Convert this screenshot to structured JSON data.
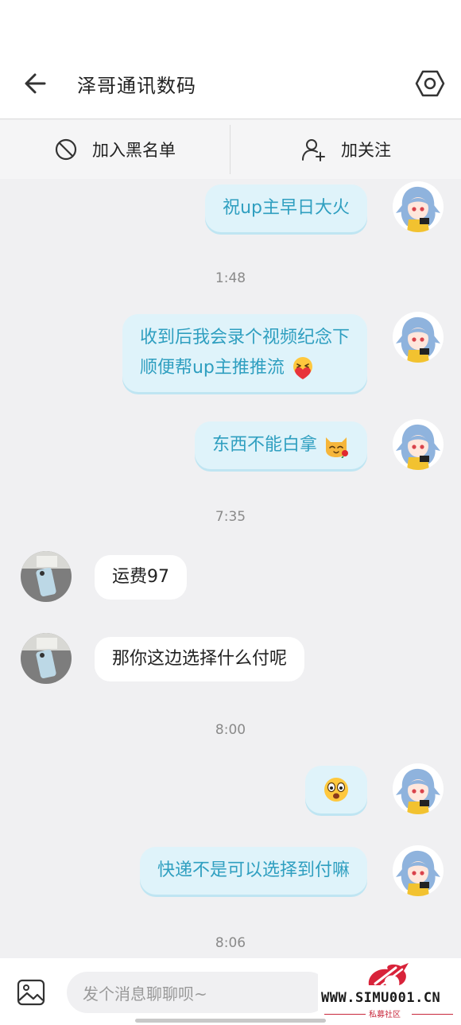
{
  "header": {
    "title": "泽哥通讯数码",
    "back_icon": "arrow-left-icon",
    "settings_icon": "hexagon-gear-icon"
  },
  "actions": {
    "block_label": "加入黑名单",
    "block_icon": "block-icon",
    "follow_label": "加关注",
    "follow_icon": "add-user-icon"
  },
  "messages": [
    {
      "type": "me",
      "text": "祝up主早日大火"
    },
    {
      "type": "time",
      "text": "1:48"
    },
    {
      "type": "me",
      "lines": [
        "收到后我会录个视频纪念下",
        "顺便帮up主推推流"
      ],
      "emoji": "heart-hug-emoji"
    },
    {
      "type": "me",
      "text": "东西不能白拿",
      "emoji": "cat-rose-emoji"
    },
    {
      "type": "time",
      "text": "7:35"
    },
    {
      "type": "them",
      "text": "运费97"
    },
    {
      "type": "them",
      "text": "那你这边选择什么付呢"
    },
    {
      "type": "time",
      "text": "8:00"
    },
    {
      "type": "me",
      "text": "",
      "emoji": "surprised-face-emoji"
    },
    {
      "type": "me",
      "text": "快递不是可以选择到付嘛"
    },
    {
      "type": "time",
      "text": "8:06"
    }
  ],
  "input": {
    "placeholder": "发个消息聊聊呗~",
    "image_icon": "image-icon"
  },
  "watermark": {
    "site": "WWW.SIMU001.CN",
    "sub": "私募社区"
  },
  "colors": {
    "my_bubble_bg": "#dff3fa",
    "my_bubble_text": "#2f9fc0",
    "their_bubble_bg": "#ffffff",
    "chat_bg": "#f0f0f2",
    "watermark_accent": "#c8283c"
  }
}
